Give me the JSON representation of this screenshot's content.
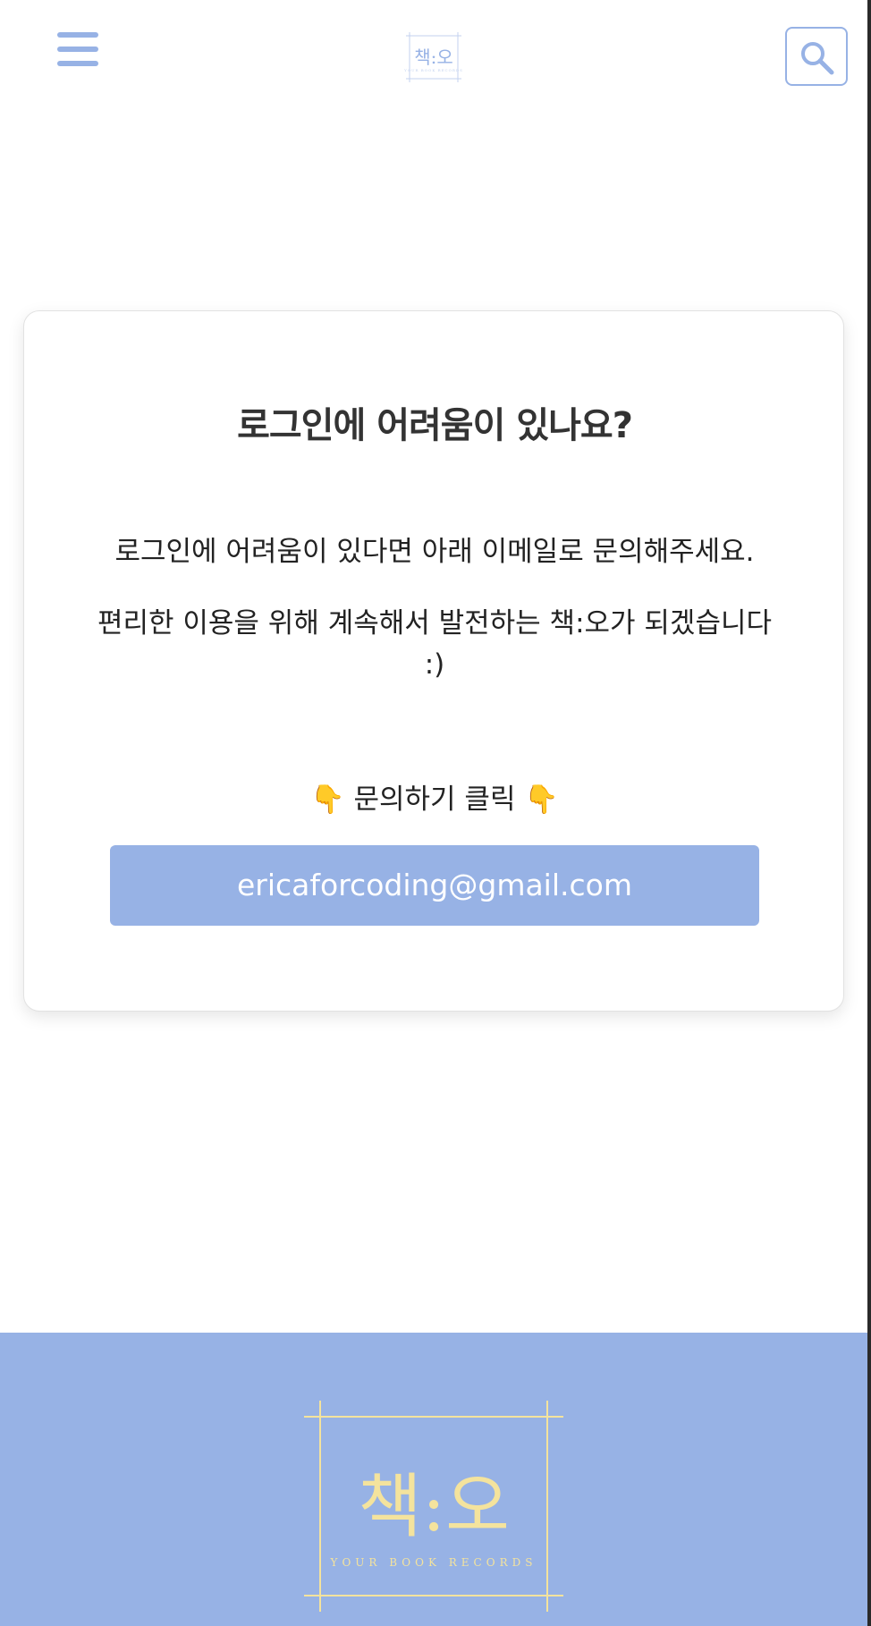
{
  "header": {
    "menu_icon": "hamburger-menu-icon",
    "logo": {
      "text": "책:오",
      "subtext": "YOUR BOOK RECORDS"
    },
    "search_icon": "search-icon"
  },
  "card": {
    "title": "로그인에 어려움이 있나요?",
    "description_1": "로그인에 어려움이 있다면 아래 이메일로 문의해주세요.",
    "description_2": "편리한 이용을 위해 계속해서 발전하는 책:오가 되겠습니다 :)",
    "click_hint": "👇 문의하기 클릭 👇",
    "email_button": "ericaforcoding@gmail.com"
  },
  "footer": {
    "logo": {
      "text": "책:오",
      "subtext": "YOUR BOOK RECORDS"
    }
  },
  "colors": {
    "accent": "#97b2e5",
    "logo_gold": "#f4e39d",
    "text_dark": "#333333"
  }
}
